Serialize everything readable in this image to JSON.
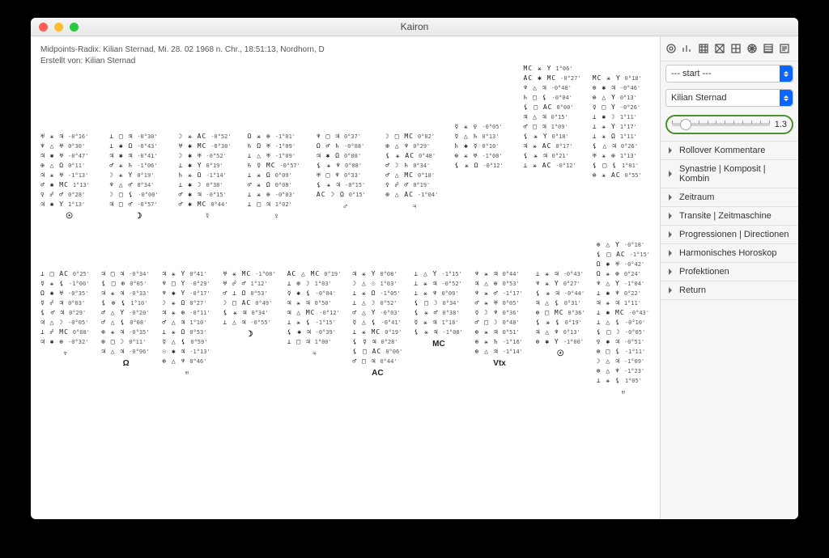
{
  "window_title": "Kairon",
  "header": {
    "line1": "Midpoints-Radix: Kilian Sternad, Mi. 28. 02 1968 n. Chr., 18:51:13, Nordhorn, D",
    "line2": "Erstellt von: Kilian Sternad"
  },
  "sidebar": {
    "select1": "--- start ---",
    "select2": "Kilian Sternad",
    "slider_value": "1.3",
    "items": [
      "Rollover Kommentare",
      "Synastrie | Komposit | Kombin",
      "Zeitraum",
      "Transite | Zeitmaschine",
      "Progressionen | Directionen",
      "Harmonisches Horoskop",
      "Profektionen",
      "Return"
    ]
  },
  "block_rows": [
    {
      "stagger": 3,
      "blocks": [
        {
          "foot": "☉",
          "lines": [
            {
              "g": "♅ ⚹ ♃",
              "v": "-0°16'"
            },
            {
              "g": "♆ △ ♅",
              "v": "0°30'"
            },
            {
              "g": "♃ ✱ ♅",
              "v": "-0°47'"
            },
            {
              "g": "⊕ △ Ω",
              "v": "0°11'"
            },
            {
              "g": "♃ ⚹ ♅",
              "v": "-1°13'"
            },
            {
              "g": "♂ ✱ MC",
              "v": "1°13'"
            },
            {
              "g": "♀ ☍ ♂",
              "v": "0°28'"
            },
            {
              "g": "♃ ✱ Y",
              "v": "1°13'"
            }
          ]
        },
        {
          "foot": "☽",
          "lines": [
            {
              "g": "⊥ □ ♃",
              "v": "-0°30'"
            },
            {
              "g": "⊥ ✱ Ω",
              "v": "-0°43'"
            },
            {
              "g": "♃ ✱ ♃",
              "v": "-0°41'"
            },
            {
              "g": "♂ ⚹ ♄",
              "v": "-1°06'"
            },
            {
              "g": "☽ ⚹ Y",
              "v": "0°19'"
            },
            {
              "g": "♆ △ ♂",
              "v": "0°34'"
            },
            {
              "g": "☽ □ ⚸",
              "v": "-0°00'"
            },
            {
              "g": "♃ □ ♂",
              "v": "-0°57'"
            }
          ]
        },
        {
          "foot": "☿",
          "lines": [
            {
              "g": "☽ ⚹ AC",
              "v": "-0°52'"
            },
            {
              "g": "♅ ✱ MC",
              "v": "-0°30'"
            },
            {
              "g": "☽ ✱ ♅",
              "v": "-0°52'"
            },
            {
              "g": "⊥ ✱ Y",
              "v": "0°19'"
            },
            {
              "g": "♄ ⚹ Ω",
              "v": "-1°14'"
            },
            {
              "g": "⊥ ✱ ☽",
              "v": "0°38'"
            },
            {
              "g": "♂ ✱ ♃",
              "v": "-0°15'"
            },
            {
              "g": "♂ ✱ MC",
              "v": "0°44'"
            }
          ]
        },
        {
          "foot": "♀",
          "lines": [
            {
              "g": "Ω ⚹ ⊕",
              "v": "-1°01'"
            },
            {
              "g": "♄ Ω ♅",
              "v": "-1°09'"
            },
            {
              "g": "⊥ △ ♅",
              "v": "-1°09'"
            },
            {
              "g": "♄ ☿ MC",
              "v": "-0°57'"
            },
            {
              "g": "⊥ ⚹ Ω",
              "v": "0°09'"
            },
            {
              "g": "♂ ⚹ Ω",
              "v": "0°08'"
            },
            {
              "g": "⊥ ⚹ ⊕",
              "v": "-0°03'"
            },
            {
              "g": "⊥ □ ♃",
              "v": "1°02'"
            }
          ]
        },
        {
          "foot": "♂",
          "lines": [
            {
              "g": "♆ □ ♃",
              "v": "0°37'"
            },
            {
              "g": "Ω ♂ ♄",
              "v": "-0°08'"
            },
            {
              "g": "♃ ✱ Ω",
              "v": "0°08'"
            },
            {
              "g": "⚸ ⚹ ♆",
              "v": "0°08'"
            },
            {
              "g": "♅ □ ♆",
              "v": "0°33'"
            },
            {
              "g": "⚸ ⚹ ♃",
              "v": "-0°15'"
            },
            {
              "g": "AC ☽ Ω",
              "v": "0°15'"
            }
          ]
        },
        {
          "foot": "♃",
          "lines": [
            {
              "g": "☽ □ MC",
              "v": "0°02'"
            },
            {
              "g": "⊕ △ ♆",
              "v": "0°29'"
            },
            {
              "g": "⚸ ⚹ AC",
              "v": "0°48'"
            },
            {
              "g": "♂ ☽ ♄",
              "v": "0°34'"
            },
            {
              "g": "♂ △ MC",
              "v": "0°18'"
            },
            {
              "g": "♀ ☍ ♂",
              "v": "0°19'"
            },
            {
              "g": "⊕ △ AC",
              "v": "-1°04'"
            }
          ]
        },
        {
          "foot": "",
          "offset": 2,
          "lines": [
            {
              "g": "☿ ⚹ ♀",
              "v": "-0°05'"
            },
            {
              "g": "☿ △ ♄",
              "v": "0°13'"
            },
            {
              "g": "♄ ✱ ☿",
              "v": "0°10'"
            },
            {
              "g": "⊕ ⚹ ♅",
              "v": "-1°08'"
            },
            {
              "g": "⚸ ⚹ Ω",
              "v": "-0°12'"
            }
          ]
        },
        {
          "foot": "",
          "offset": -4,
          "lines": [
            {
              "g": "MC ⚹ Y",
              "v": "1°06'"
            },
            {
              "g": "AC ✱ MC",
              "v": "-0°27'"
            },
            {
              "g": "♆ △ ♃",
              "v": "-0°48'"
            },
            {
              "g": "♄ □ ⚸",
              "v": "-0°04'"
            },
            {
              "g": "⚸ □ AC",
              "v": "0°00'"
            },
            {
              "g": "♃ △ ♃",
              "v": "0°15'"
            },
            {
              "g": "♂ □ ♃",
              "v": "1°09'"
            },
            {
              "g": "⚸ ⚹ Y",
              "v": "0°18'"
            },
            {
              "g": "♃ ⚹ AC",
              "v": "0°17'"
            },
            {
              "g": "⚸ ⚹ ♃",
              "v": "0°21'"
            },
            {
              "g": "⊥ ⚹ AC",
              "v": "-0°12'"
            }
          ]
        },
        {
          "foot": "",
          "offset": -3,
          "lines": [
            {
              "g": "MC ⚹ Y",
              "v": "0°18'"
            },
            {
              "g": "⊕ ✱ ♃",
              "v": "-0°46'"
            },
            {
              "g": "⊕ △ Y",
              "v": "0°13'"
            },
            {
              "g": "☿ □ Y",
              "v": "-0°26'"
            },
            {
              "g": "⊥ ✱ ☽",
              "v": "1°11'"
            },
            {
              "g": "⊥ ⚹ Y",
              "v": "1°17'"
            },
            {
              "g": "⊥ ⚹ Ω",
              "v": "1°11'"
            },
            {
              "g": "⚸ △ ♃",
              "v": "0°26'"
            },
            {
              "g": "♅ ⚹ ⊕",
              "v": "1°13'"
            },
            {
              "g": "⚸ □ ⚸",
              "v": "1°01'"
            },
            {
              "g": "⊕ ⚹ AC",
              "v": "0°55'"
            }
          ]
        }
      ]
    },
    {
      "stagger": 0,
      "blocks": [
        {
          "foot": "♆",
          "lines": [
            {
              "g": "⊥ □ AC",
              "v": "0°25'"
            },
            {
              "g": "☿ ⚹ ⚸",
              "v": "-1°00'"
            },
            {
              "g": "Ω ✱ ♅",
              "v": "-0°35'"
            },
            {
              "g": "☿ ☍ ♃",
              "v": "0°03'"
            },
            {
              "g": "⚸ ♂ ♃",
              "v": "0°29'"
            },
            {
              "g": "♃ △ ☽",
              "v": "-0°05'"
            },
            {
              "g": "⊥ ☍ MC",
              "v": "0°08'"
            },
            {
              "g": "♃ ✱ ⊕",
              "v": "-0°32'"
            }
          ]
        },
        {
          "foot": "Ω",
          "lines": [
            {
              "g": "♃ □ ♃",
              "v": "-0°34'"
            },
            {
              "g": "⚸ □ ⊕",
              "v": "0°05'"
            },
            {
              "g": "♃ ⚹ ♃",
              "v": "-0°33'"
            },
            {
              "g": "⚸ ⊕ ⚸",
              "v": "1°10'"
            },
            {
              "g": "♂ △ Y",
              "v": "-0°20'"
            },
            {
              "g": "♂ △ ⚸",
              "v": "0°08'"
            },
            {
              "g": "⊕ ⚹ ♃",
              "v": "-0°35'"
            },
            {
              "g": "⊕ □ ☽",
              "v": "0°11'"
            },
            {
              "g": "♃ △ ♃",
              "v": "-0°96'"
            }
          ]
        },
        {
          "foot": "♅",
          "lines": [
            {
              "g": "♃ ⚹ Y",
              "v": "0°41'"
            },
            {
              "g": "♆ □ Y",
              "v": "-0°29'"
            },
            {
              "g": "♆ ✱ Y",
              "v": "-0°17'"
            },
            {
              "g": "☽ ⚹ Ω",
              "v": "0°27'"
            },
            {
              "g": "♃ ⚹ ⊕",
              "v": "-0°11'"
            },
            {
              "g": "♂ △ ♃",
              "v": "1°10'"
            },
            {
              "g": "⊥ ⚹ Ω",
              "v": "0°53'"
            },
            {
              "g": "☿ △ ⚸",
              "v": "0°59'"
            },
            {
              "g": "☉ ✱ ♃",
              "v": "-1°13'"
            },
            {
              "g": "⊕ △ ♆",
              "v": "0°46'"
            }
          ]
        },
        {
          "foot": "☽",
          "lines": [
            {
              "g": "♅ ⚹ MC",
              "v": "-1°08'"
            },
            {
              "g": "♅ ☍ ♂",
              "v": "1°12'"
            },
            {
              "g": "♂ ⊥ Ω",
              "v": "0°53'"
            },
            {
              "g": "☽ □ AC",
              "v": "0°49'"
            },
            {
              "g": "⚸ ⚹ ♃",
              "v": "0°34'"
            },
            {
              "g": "⊥ △ ♃",
              "v": "-0°55'"
            }
          ]
        },
        {
          "foot": "♃",
          "lines": [
            {
              "g": "AC △ MC",
              "v": "0°19'"
            },
            {
              "g": "⊥ ⊕ ☽",
              "v": "1°03'"
            },
            {
              "g": "☿ ✱ ⚸",
              "v": "-0°04'"
            },
            {
              "g": "♃ ⚹ ♃",
              "v": "0°50'"
            },
            {
              "g": "♃ △ MC",
              "v": "-0°12'"
            },
            {
              "g": "⊥ ⚹ ⚸",
              "v": "-1°15'"
            },
            {
              "g": "⚸ ✱ ♃",
              "v": "-0°39'"
            },
            {
              "g": "⊥ □ ♃",
              "v": "1°00'"
            }
          ]
        },
        {
          "foot": "AC",
          "lines": [
            {
              "g": "♃ ⚹ Y",
              "v": "0°08'"
            },
            {
              "g": "☽ △ ☉",
              "v": "1°03'"
            },
            {
              "g": "⊥ ⚹ Ω",
              "v": "-1°05'"
            },
            {
              "g": "⊥ △ ☽",
              "v": "0°52'"
            },
            {
              "g": "♂ △ Y",
              "v": "-0°03'"
            },
            {
              "g": "☿ △ ⚸",
              "v": "-0°41'"
            },
            {
              "g": "⊥ ⚹ MC",
              "v": "0°19'"
            },
            {
              "g": "⚸ ☿ ♃",
              "v": "0°28'"
            },
            {
              "g": "⚸ □ AC",
              "v": "0°06'"
            },
            {
              "g": "♂ □ ♃",
              "v": "0°44'"
            }
          ]
        },
        {
          "foot": "MC",
          "lines": [
            {
              "g": "⊥ △ Y",
              "v": "-1°15'"
            },
            {
              "g": "⊥ ⚹ ♃",
              "v": "-0°52'"
            },
            {
              "g": "⊥ ⚹ ♆",
              "v": "0°09'"
            },
            {
              "g": "⚸ □ ☽",
              "v": "0°34'"
            },
            {
              "g": "⚸ ⚹ ♂",
              "v": "0°38'"
            },
            {
              "g": "☿ ⚹ ♃",
              "v": "1°18'"
            },
            {
              "g": "⚸ ⚹ ♃",
              "v": "-1°08'"
            }
          ]
        },
        {
          "foot": "Vtx",
          "lines": [
            {
              "g": "♆ ⚹ ♃",
              "v": "0°44'"
            },
            {
              "g": "♃ △ ⊕",
              "v": "0°53'"
            },
            {
              "g": "♆ ⚹ ♂",
              "v": "-1°17'"
            },
            {
              "g": "♂ ⚹ ♅",
              "v": "0°05'"
            },
            {
              "g": "☿ ☽ ♆",
              "v": "0°36'"
            },
            {
              "g": "♂ □ ☽",
              "v": "0°48'"
            },
            {
              "g": "⊕ ⚹ ♃",
              "v": "0°51'"
            },
            {
              "g": "⊕ ⚹ ♄",
              "v": "-1°16'"
            },
            {
              "g": "⊕ △ ♃",
              "v": "-1°14'"
            }
          ]
        },
        {
          "foot": "☉",
          "lines": [
            {
              "g": "⊥ ⚹ ♃",
              "v": "-0°43'"
            },
            {
              "g": "♆ ⚹ Y",
              "v": "0°27'"
            },
            {
              "g": "⚸ ⚹ ♃",
              "v": "-0°44'"
            },
            {
              "g": "♃ △ ⚸",
              "v": "0°31'"
            },
            {
              "g": "⊕ □ MC",
              "v": "0°36'"
            },
            {
              "g": "⚸ ⚹ ⚸",
              "v": "0°19'"
            },
            {
              "g": "♃ △ ♆",
              "v": "0°13'"
            },
            {
              "g": "⊕ ✱ Y",
              "v": "-1°00'"
            }
          ]
        },
        {
          "foot": "♅",
          "offset": -3,
          "lines": [
            {
              "g": "⊕ △ Y",
              "v": "-0°18'"
            },
            {
              "g": "⚸ □ AC",
              "v": "-1°15'"
            },
            {
              "g": "Ω ✱ ♅",
              "v": "-0°42'"
            },
            {
              "g": "Ω ⚹ ⊕",
              "v": "0°24'"
            },
            {
              "g": "♆ △ Y",
              "v": "-1°04'"
            },
            {
              "g": "⊥ ✱ ♆",
              "v": "0°22'"
            },
            {
              "g": "♃ ⚹ ♃",
              "v": "1°11'"
            },
            {
              "g": "⊥ ✱ MC",
              "v": "-0°43'"
            },
            {
              "g": "⊥ △ ⚸",
              "v": "-0°10'"
            },
            {
              "g": "⚸ □ ☽",
              "v": "-0°05'"
            },
            {
              "g": "♀ ✱ ♃",
              "v": "-0°51'"
            },
            {
              "g": "⊕ □ ⚸",
              "v": "-1°11'"
            },
            {
              "g": "☽ △ ♃",
              "v": "-1°09'"
            },
            {
              "g": "⊕ △ ♆",
              "v": "-1°23'"
            },
            {
              "g": "⊥ ⚹ ⚸",
              "v": "1°05'"
            }
          ]
        }
      ]
    }
  ]
}
